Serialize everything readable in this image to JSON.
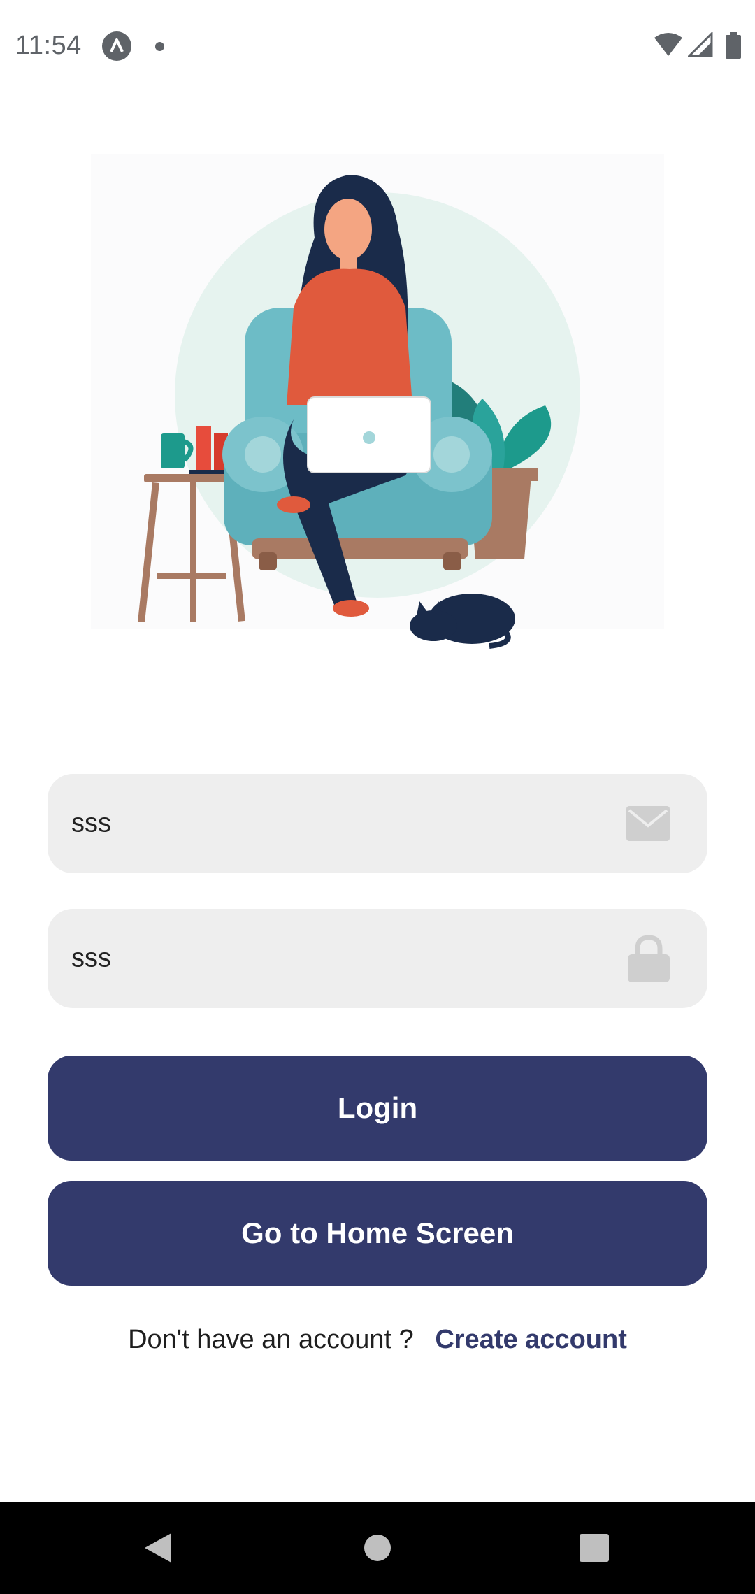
{
  "status_bar": {
    "time": "11:54",
    "icons": [
      "app-notification-icon",
      "dot-icon",
      "wifi-icon",
      "signal-icon",
      "battery-icon"
    ]
  },
  "hero": {
    "illustration": "woman-with-laptop-on-armchair"
  },
  "form": {
    "email": {
      "value": "sss",
      "icon": "mail-icon"
    },
    "password": {
      "value": "sss",
      "icon": "lock-icon"
    }
  },
  "actions": {
    "login_label": "Login",
    "home_label": "Go to Home Screen"
  },
  "signup": {
    "prompt": "Don't have an account ?",
    "link_label": "Create account"
  },
  "nav_bar": {
    "icons": [
      "back-icon",
      "home-icon",
      "recents-icon"
    ]
  },
  "colors": {
    "primary": "#333a6c",
    "field_bg": "#eeeeee",
    "nav_bg": "#000000"
  }
}
